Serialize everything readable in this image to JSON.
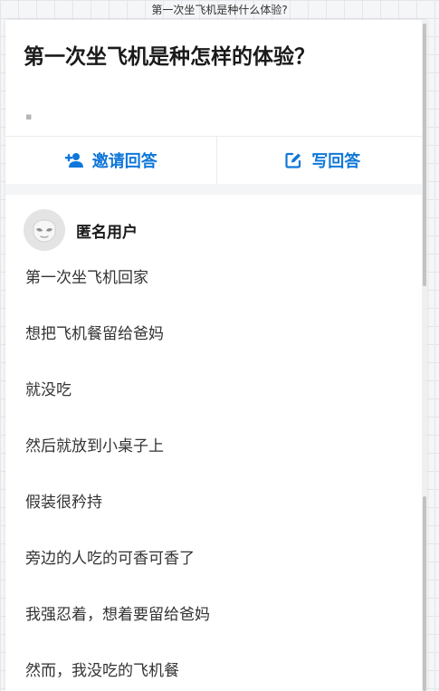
{
  "window": {
    "title": "第一次坐飞机是种什么体验?"
  },
  "question": {
    "title": "第一次坐飞机是种怎样的体验？",
    "description": "▪"
  },
  "actions": {
    "invite": {
      "label": "邀请回答",
      "icon": "add-person-icon"
    },
    "write": {
      "label": "写回答",
      "icon": "edit-icon"
    }
  },
  "answer": {
    "author": "匿名用户",
    "avatar_icon": "anonymous-avatar-icon",
    "lines": [
      "第一次坐飞机回家",
      "想把飞机餐留给爸妈",
      "就没吃",
      "然后就放到小桌子上",
      "假装很矜持",
      "旁边的人吃的可香可香了",
      "我强忍着，想着要留给爸妈",
      "然而，我没吃的飞机餐"
    ]
  },
  "colors": {
    "accent": "#0f77d9",
    "title_text": "#1a1a1a",
    "body_text": "#333333"
  }
}
